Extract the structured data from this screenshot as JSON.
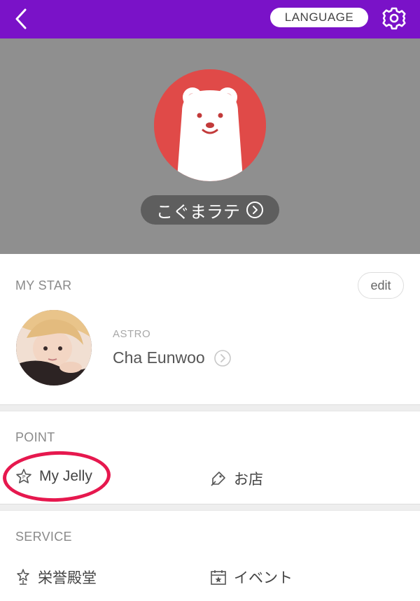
{
  "header": {
    "language_label": "LANGUAGE"
  },
  "profile": {
    "nickname": "こぐまラテ"
  },
  "my_star": {
    "section_title": "MY STAR",
    "edit_label": "edit",
    "group": "ASTRO",
    "name": "Cha Eunwoo"
  },
  "point": {
    "section_title": "POINT",
    "my_jelly_label": "My Jelly",
    "shop_label": "お店"
  },
  "service": {
    "section_title": "SERVICE",
    "hall_of_fame_label": "栄誉殿堂",
    "event_label": "イベント"
  },
  "colors": {
    "header_purple": "#7a12c8",
    "profile_bg": "#8f8f8f",
    "avatar_red": "#e04a48",
    "highlight_red": "#e6184e"
  },
  "icons": [
    "back-arrow-icon",
    "gear-icon",
    "chevron-circle-icon",
    "star-p-icon",
    "shop-tag-icon",
    "trophy-star-icon",
    "calendar-star-icon"
  ]
}
